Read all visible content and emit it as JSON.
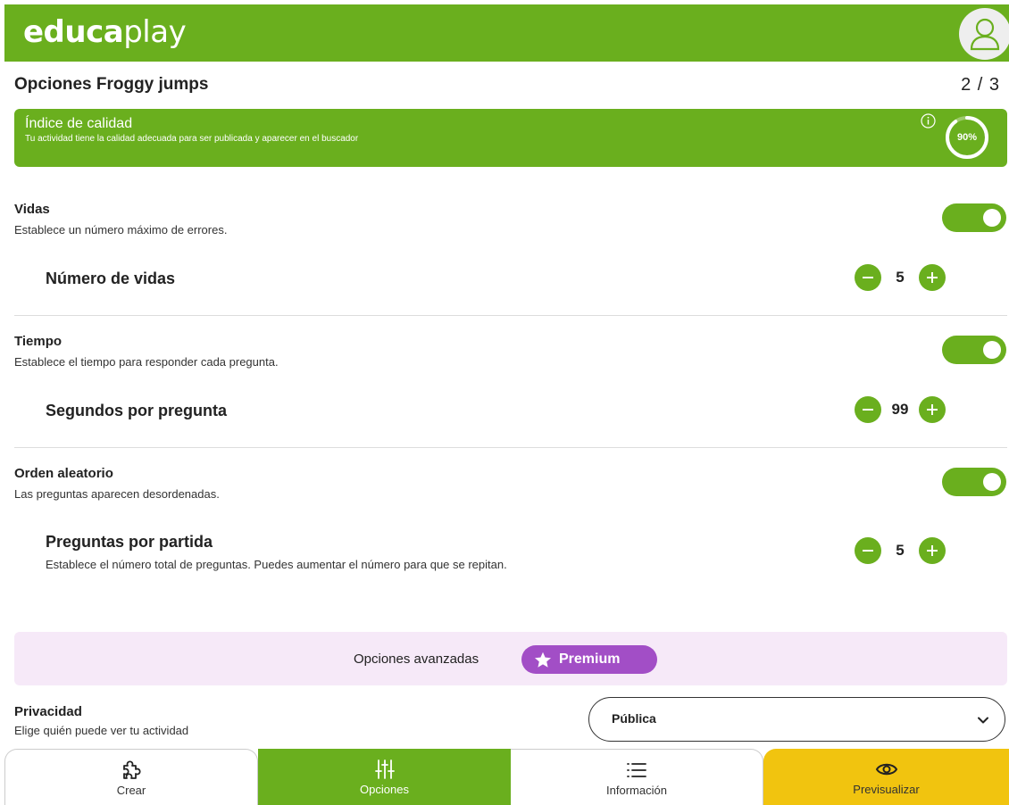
{
  "brand": {
    "logo_bold": "educa",
    "logo_light": "play",
    "accent": "#6aaf1e"
  },
  "header": {
    "title": "Opciones Froggy jumps",
    "step": "2 / 3"
  },
  "quality": {
    "title": "Índice de calidad",
    "description": "Tu actividad tiene la calidad adecuada para ser publicada y aparecer en el buscador",
    "value_label": "90%",
    "value": 0.9
  },
  "options": [
    {
      "title": "Vidas",
      "description": "Establece un número máximo de errores.",
      "enabled": true,
      "sub": {
        "title": "Número de vidas",
        "description": "",
        "value": "5"
      }
    },
    {
      "title": "Tiempo",
      "description": "Establece el tiempo para responder cada pregunta.",
      "enabled": true,
      "sub": {
        "title": "Segundos por pregunta",
        "description": "",
        "value": "99"
      }
    },
    {
      "title": "Orden aleatorio",
      "description": "Las preguntas aparecen desordenadas.",
      "enabled": true,
      "sub": {
        "title": "Preguntas por partida",
        "description": "Establece el número total de preguntas. Puedes aumentar el número para que se repitan.",
        "value": "5"
      }
    }
  ],
  "advanced": {
    "label": "Opciones avanzadas",
    "premium_label": "Premium",
    "premium_color": "#a24ec6"
  },
  "privacy": {
    "title": "Privacidad",
    "description": "Elige quién puede ver tu actividad",
    "selected": "Pública"
  },
  "nav": {
    "crear": "Crear",
    "opciones": "Opciones",
    "informacion": "Información",
    "previsualizar": "Previsualizar",
    "preview_color": "#f1c40f"
  },
  "icons": [
    "user-icon",
    "info-icon",
    "minus-icon",
    "plus-icon",
    "star-icon",
    "chevron-down-icon",
    "puzzle-icon",
    "sliders-icon",
    "list-icon",
    "eye-icon"
  ]
}
